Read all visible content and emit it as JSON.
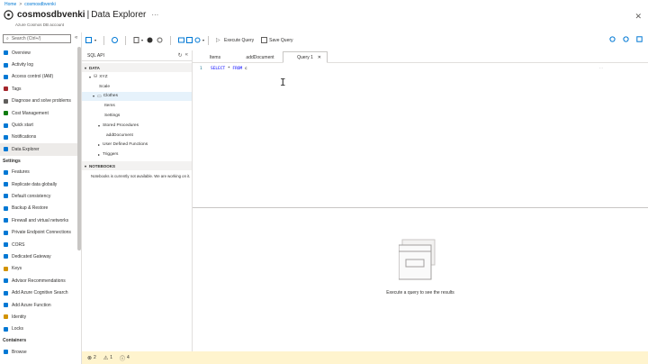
{
  "breadcrumb": {
    "home": "Home",
    "resource": "cosmosdbvenki"
  },
  "header": {
    "resource_name": "cosmosdbvenki",
    "separator": "|",
    "page_title": "Data Explorer",
    "more": "···",
    "subtitle": "Azure Cosmos DB account",
    "close": "✕"
  },
  "sidebar": {
    "search_placeholder": "Search (Ctrl+/)",
    "collapse": "«",
    "items": [
      {
        "label": "Overview",
        "color": "#0078d4"
      },
      {
        "label": "Activity log",
        "color": "#0078d4"
      },
      {
        "label": "Access control (IAM)",
        "color": "#0078d4"
      },
      {
        "label": "Tags",
        "color": "#a4262c"
      },
      {
        "label": "Diagnose and solve problems",
        "color": "#605e5c"
      },
      {
        "label": "Cost Management",
        "color": "#107c10"
      },
      {
        "label": "Quick start",
        "color": "#0078d4"
      },
      {
        "label": "Notifications",
        "color": "#0078d4"
      },
      {
        "label": "Data Explorer",
        "color": "#0078d4",
        "active": true
      }
    ],
    "settings_header": "Settings",
    "settings_items": [
      {
        "label": "Features",
        "color": "#0078d4"
      },
      {
        "label": "Replicate data globally",
        "color": "#0078d4"
      },
      {
        "label": "Default consistency",
        "color": "#0078d4"
      },
      {
        "label": "Backup & Restore",
        "color": "#0078d4"
      },
      {
        "label": "Firewall and virtual networks",
        "color": "#0078d4"
      },
      {
        "label": "Private Endpoint Connections",
        "color": "#0078d4"
      },
      {
        "label": "CORS",
        "color": "#0078d4"
      },
      {
        "label": "Dedicated Gateway",
        "color": "#0078d4"
      },
      {
        "label": "Keys",
        "color": "#d29200"
      },
      {
        "label": "Advisor Recommendations",
        "color": "#0078d4"
      },
      {
        "label": "Add Azure Cognitive Search",
        "color": "#0078d4"
      },
      {
        "label": "Add Azure Function",
        "color": "#0078d4"
      },
      {
        "label": "Identity",
        "color": "#d29200"
      },
      {
        "label": "Locks",
        "color": "#0078d4"
      }
    ],
    "containers_header": "Containers",
    "containers_items": [
      {
        "label": "Browse",
        "color": "#0078d4"
      }
    ]
  },
  "toolbar": {
    "execute_query": "Execute Query",
    "save_query": "Save Query"
  },
  "tree": {
    "api_label": "SQL API",
    "data_section": "DATA",
    "database": "XYZ",
    "container": "Clothes",
    "scale": "Scale",
    "items": "Items",
    "settings": "Settings",
    "stored_procedures": "Stored Procedures",
    "stored_procedure_item": "addDocument",
    "udf": "User Defined Functions",
    "triggers": "Triggers",
    "notebooks_section": "NOTEBOOKS",
    "notebooks_msg": "Notebooks is currently not available. We are working on it."
  },
  "tabs": [
    {
      "label": "Items",
      "active": false
    },
    {
      "label": "addDocument",
      "active": false
    },
    {
      "label": "Query 1",
      "active": true
    }
  ],
  "editor": {
    "line_number": "1",
    "keyword_select": "SELECT",
    "star": "*",
    "keyword_from": "FROM",
    "alias": "c"
  },
  "results": {
    "message": "Execute a query to see the results"
  },
  "status": {
    "errors": "2",
    "warnings": "1",
    "info": "4"
  }
}
